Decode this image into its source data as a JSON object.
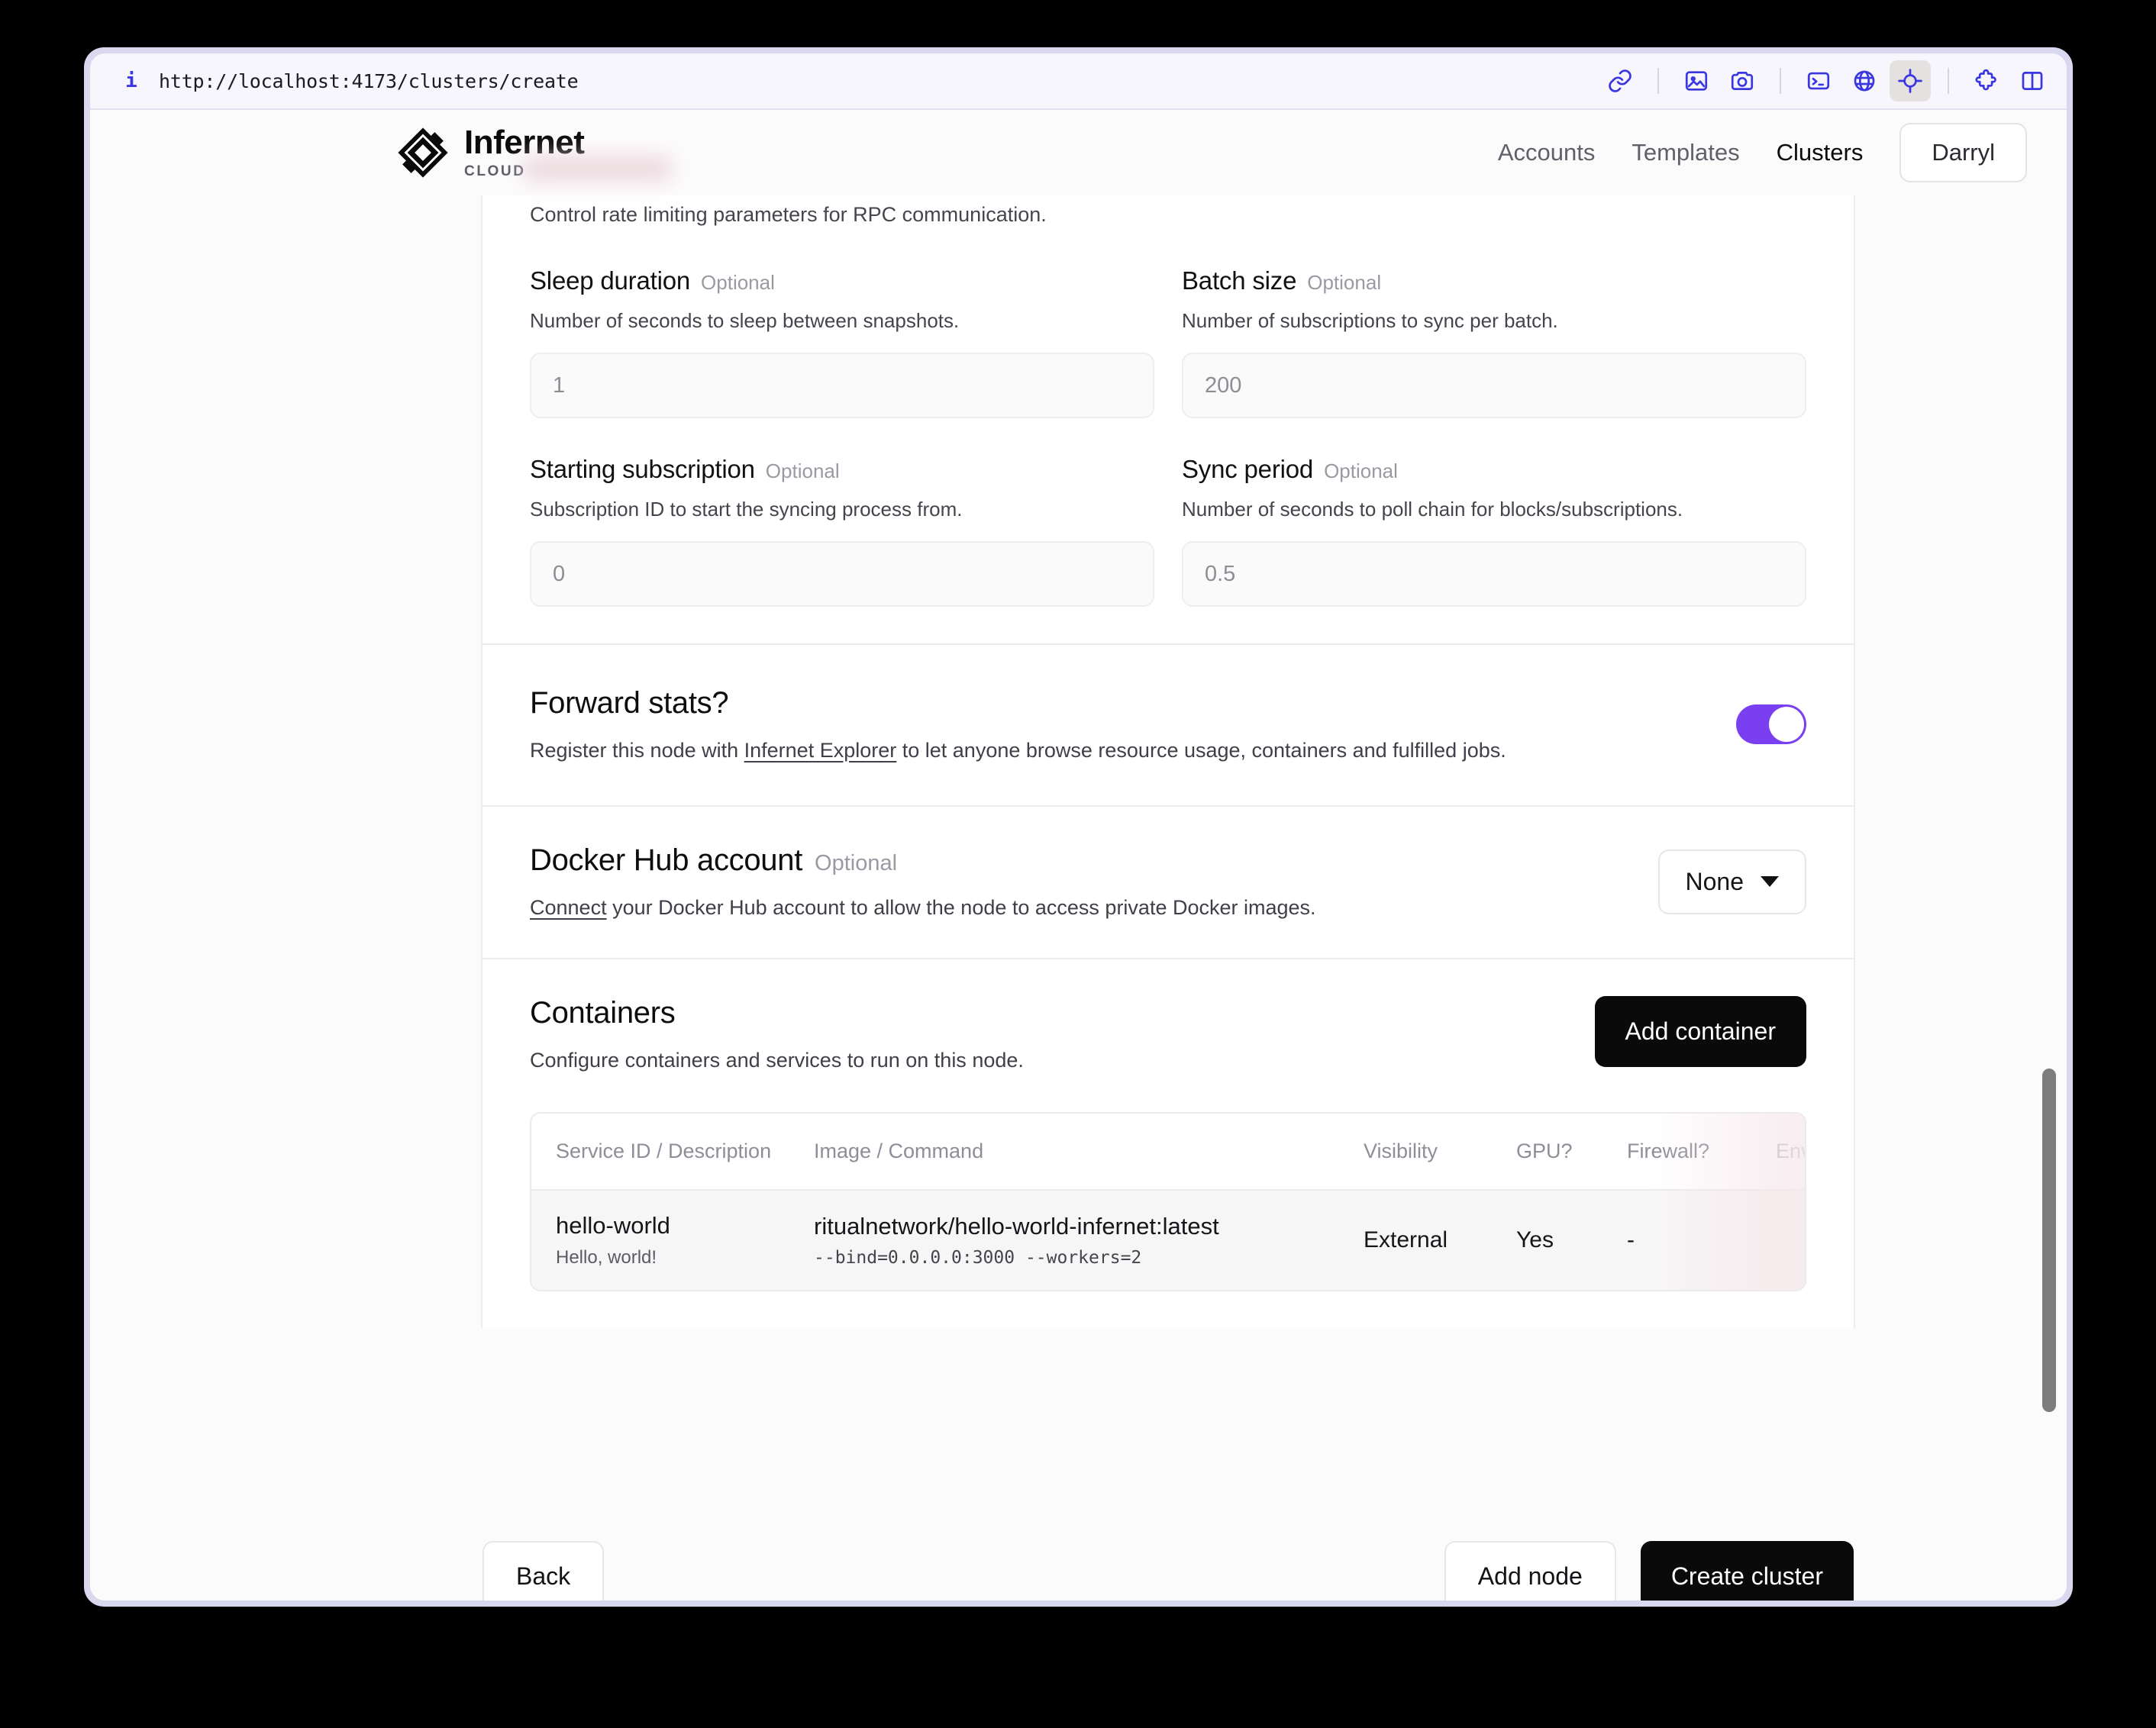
{
  "browser": {
    "url": "http://localhost:4173/clusters/create",
    "info_icon": "info-icon",
    "toolbar_icons": [
      "link-icon",
      "image-icon",
      "camera-icon",
      "terminal-icon",
      "globe-icon",
      "target-icon",
      "puzzle-icon",
      "split-panel-icon"
    ]
  },
  "header": {
    "brand_name": "Infernet",
    "brand_sub": "CLOUD",
    "nav": [
      {
        "label": "Accounts",
        "active": false
      },
      {
        "label": "Templates",
        "active": false
      },
      {
        "label": "Clusters",
        "active": true
      }
    ],
    "user": "Darryl"
  },
  "form": {
    "lead_description": "Control rate limiting parameters for RPC communication.",
    "optional_tag": "Optional",
    "fields": [
      {
        "label": "Sleep duration",
        "optional": "Optional",
        "description": "Number of seconds to sleep between snapshots.",
        "placeholder": "1",
        "value": ""
      },
      {
        "label": "Batch size",
        "optional": "Optional",
        "description": "Number of subscriptions to sync per batch.",
        "placeholder": "200",
        "value": ""
      },
      {
        "label": "Starting subscription",
        "optional": "Optional",
        "description": "Subscription ID to start the syncing process from.",
        "placeholder": "0",
        "value": ""
      },
      {
        "label": "Sync period",
        "optional": "Optional",
        "description": "Number of seconds to poll chain for blocks/subscriptions.",
        "placeholder": "0.5",
        "value": ""
      }
    ]
  },
  "forward_stats": {
    "title": "Forward stats?",
    "desc_before": "Register this node with ",
    "link": "Infernet Explorer",
    "desc_after": " to let anyone browse resource usage, containers and fulfilled jobs.",
    "toggle_on": true,
    "toggle_color": "#7b3ff2"
  },
  "docker": {
    "title": "Docker Hub account",
    "optional": "Optional",
    "link": "Connect",
    "desc_after": " your Docker Hub account to allow the node to access private Docker images.",
    "select_value": "None"
  },
  "containers": {
    "title": "Containers",
    "description": "Configure containers and services to run on this node.",
    "add_button": "Add container",
    "columns": [
      "Service ID / Description",
      "Image / Command",
      "Visibility",
      "GPU?",
      "Firewall?",
      "Env"
    ],
    "rows": [
      {
        "service_id": "hello-world",
        "service_desc": "Hello, world!",
        "image": "ritualnetwork/hello-world-infernet:latest",
        "command": "--bind=0.0.0.0:3000 --workers=2",
        "visibility": "External",
        "gpu": "Yes",
        "firewall": "-"
      }
    ]
  },
  "footer": {
    "back": "Back",
    "add_node": "Add node",
    "create_cluster": "Create cluster"
  }
}
